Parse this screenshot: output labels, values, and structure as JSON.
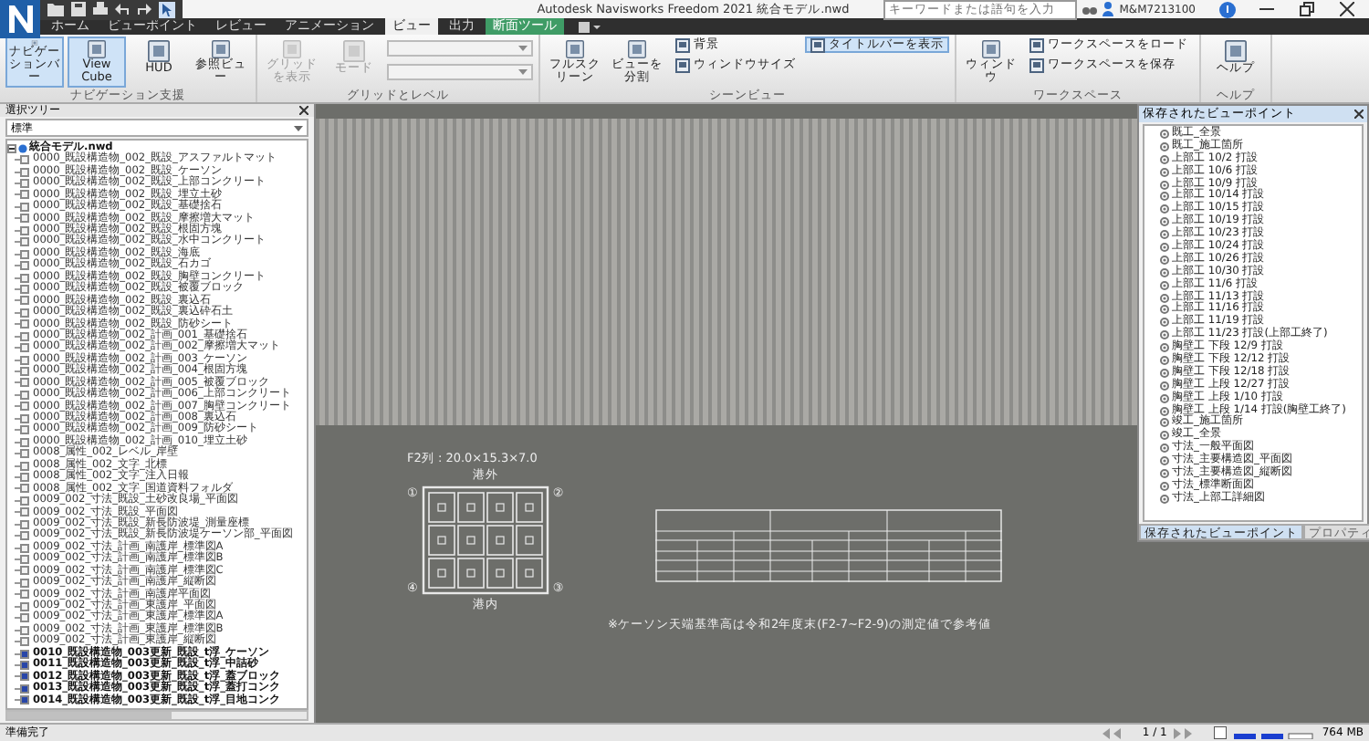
{
  "window": {
    "title": "Autodesk Navisworks Freedom 2021   統合モデル.nwd",
    "search_placeholder": "キーワードまたは語句を入力",
    "user": "M&M7213100"
  },
  "ribbon": {
    "tabs": [
      {
        "label": "ホーム",
        "selected": false,
        "kind": "normal"
      },
      {
        "label": "ビューポイント",
        "selected": false,
        "kind": "normal"
      },
      {
        "label": "レビュー",
        "selected": false,
        "kind": "normal"
      },
      {
        "label": "アニメーション",
        "selected": false,
        "kind": "normal"
      },
      {
        "label": "ビュー",
        "selected": true,
        "kind": "normal"
      },
      {
        "label": "出力",
        "selected": false,
        "kind": "normal"
      },
      {
        "label": "断面ツール",
        "selected": false,
        "kind": "contextual"
      }
    ],
    "groups": [
      {
        "label": "ナビゲーション支援",
        "buttons": [
          {
            "label": "ナビゲーションバー",
            "kind": "large",
            "active": true,
            "disabled": false
          },
          {
            "label": "View Cube",
            "kind": "large",
            "active": true,
            "disabled": false
          },
          {
            "label": "HUD",
            "kind": "large",
            "active": false,
            "disabled": false
          },
          {
            "label": "参照ビュー",
            "kind": "large",
            "active": false,
            "disabled": false
          }
        ]
      },
      {
        "label": "グリッドとレベル",
        "buttons": [
          {
            "label": "グリッドを表示",
            "kind": "large",
            "active": false,
            "disabled": true
          },
          {
            "label": "モード",
            "kind": "large",
            "active": false,
            "disabled": true
          },
          {
            "kind": "combo",
            "disabled": true
          },
          {
            "kind": "combo",
            "disabled": true
          }
        ]
      },
      {
        "label": "シーンビュー",
        "buttons": [
          {
            "label": "フルスクリーン",
            "kind": "large",
            "active": false,
            "disabled": false
          },
          {
            "label": "ビューを分割",
            "kind": "large",
            "active": false,
            "disabled": false
          },
          {
            "label": "背景",
            "kind": "small",
            "active": false,
            "disabled": false
          },
          {
            "label": "ウィンドウサイズ",
            "kind": "small",
            "active": false,
            "disabled": false
          },
          {
            "label": "タイトルバーを表示",
            "kind": "small",
            "active": true,
            "disabled": false
          }
        ]
      },
      {
        "label": "ワークスペース",
        "buttons": [
          {
            "label": "ウィンドウ",
            "kind": "large",
            "active": false,
            "disabled": false
          },
          {
            "label": "ワークスペースをロード",
            "kind": "small",
            "active": false,
            "disabled": false
          },
          {
            "label": "ワークスペースを保存",
            "kind": "small",
            "active": false,
            "disabled": false
          }
        ]
      },
      {
        "label": "ヘルプ",
        "buttons": [
          {
            "label": "ヘルプ",
            "kind": "large",
            "active": false,
            "disabled": false
          }
        ]
      }
    ]
  },
  "selection_tree": {
    "title": "選択ツリー",
    "filter": "標準",
    "root": {
      "label": "統合モデル.nwd",
      "expanded": true,
      "children": [
        {
          "label": "0000_既設構造物_002_既設_アスファルトマット",
          "emphasized": false
        },
        {
          "label": "0000_既設構造物_002_既設_ケーソン",
          "emphasized": false
        },
        {
          "label": "0000_既設構造物_002_既設_上部コンクリート",
          "emphasized": false
        },
        {
          "label": "0000_既設構造物_002_既設_埋立土砂",
          "emphasized": false
        },
        {
          "label": "0000_既設構造物_002_既設_基礎捨石",
          "emphasized": false
        },
        {
          "label": "0000_既設構造物_002_既設_摩擦増大マット",
          "emphasized": false
        },
        {
          "label": "0000_既設構造物_002_既設_根固方塊",
          "emphasized": false
        },
        {
          "label": "0000_既設構造物_002_既設_水中コンクリート",
          "emphasized": false
        },
        {
          "label": "0000_既設構造物_002_既設_海底",
          "emphasized": false
        },
        {
          "label": "0000_既設構造物_002_既設_石カゴ",
          "emphasized": false
        },
        {
          "label": "0000_既設構造物_002_既設_胸壁コンクリート",
          "emphasized": false
        },
        {
          "label": "0000_既設構造物_002_既設_被覆ブロック",
          "emphasized": false
        },
        {
          "label": "0000_既設構造物_002_既設_裏込石",
          "emphasized": false
        },
        {
          "label": "0000_既設構造物_002_既設_裏込砕石土",
          "emphasized": false
        },
        {
          "label": "0000_既設構造物_002_既設_防砂シート",
          "emphasized": false
        },
        {
          "label": "0000_既設構造物_002_計画_001_基礎捨石",
          "emphasized": false
        },
        {
          "label": "0000_既設構造物_002_計画_002_摩擦増大マット",
          "emphasized": false
        },
        {
          "label": "0000_既設構造物_002_計画_003_ケーソン",
          "emphasized": false
        },
        {
          "label": "0000_既設構造物_002_計画_004_根固方塊",
          "emphasized": false
        },
        {
          "label": "0000_既設構造物_002_計画_005_被覆ブロック",
          "emphasized": false
        },
        {
          "label": "0000_既設構造物_002_計画_006_上部コンクリート",
          "emphasized": false
        },
        {
          "label": "0000_既設構造物_002_計画_007_胸壁コンクリート",
          "emphasized": false
        },
        {
          "label": "0000_既設構造物_002_計画_008_裏込石",
          "emphasized": false
        },
        {
          "label": "0000_既設構造物_002_計画_009_防砂シート",
          "emphasized": false
        },
        {
          "label": "0000_既設構造物_002_計画_010_埋立土砂",
          "emphasized": false
        },
        {
          "label": "0008_属性_002_レベル_岸壁",
          "emphasized": false
        },
        {
          "label": "0008_属性_002_文字_北標",
          "emphasized": false
        },
        {
          "label": "0008_属性_002_文字_注入日報",
          "emphasized": false
        },
        {
          "label": "0008_属性_002_文字_国道資料フォルダ",
          "emphasized": false
        },
        {
          "label": "0009_002_寸法_既設_土砂改良場_平面図",
          "emphasized": false
        },
        {
          "label": "0009_002_寸法_既設_平面図",
          "emphasized": false
        },
        {
          "label": "0009_002_寸法_既設_新長防波堤_測量座標",
          "emphasized": false
        },
        {
          "label": "0009_002_寸法_既設_新長防波堤ケーソン部_平面図",
          "emphasized": false
        },
        {
          "label": "0009_002_寸法_計画_南護岸_標準図A",
          "emphasized": false
        },
        {
          "label": "0009_002_寸法_計画_南護岸_標準図B",
          "emphasized": false
        },
        {
          "label": "0009_002_寸法_計画_南護岸_標準図C",
          "emphasized": false
        },
        {
          "label": "0009_002_寸法_計画_南護岸_縦断図",
          "emphasized": false
        },
        {
          "label": "0009_002_寸法_計画_南護岸平面図",
          "emphasized": false
        },
        {
          "label": "0009_002_寸法_計画_東護岸_平面図",
          "emphasized": false
        },
        {
          "label": "0009_002_寸法_計画_東護岸_標準図A",
          "emphasized": false
        },
        {
          "label": "0009_002_寸法_計画_東護岸_標準図B",
          "emphasized": false
        },
        {
          "label": "0009_002_寸法_計画_東護岸_縦断図",
          "emphasized": false
        },
        {
          "label": "0010_既設構造物_003更新_既設_t浮_ケーソン",
          "emphasized": true
        },
        {
          "label": "0011_既設構造物_003更新_既設_t浮_中詰砂",
          "emphasized": true
        },
        {
          "label": "0012_既設構造物_003更新_既設_t浮_蓋ブロック",
          "emphasized": true
        },
        {
          "label": "0013_既設構造物_003更新_既設_t浮_蓋打コンク",
          "emphasized": true
        },
        {
          "label": "0014_既設構造物_003更新_既設_t浮_目地コンク",
          "emphasized": true
        }
      ]
    }
  },
  "viewport": {
    "section_title": "F2列 : 20.0×15.3×7.0",
    "top_label": "港外",
    "bottom_label": "港内",
    "corners": [
      "①",
      "②",
      "④",
      "③"
    ],
    "note": "※ケーソン天端基準高は令和2年度末(F2-7~F2-9)の測定値で参考値"
  },
  "viewpoints_panel": {
    "title": "保存されたビューポイント",
    "items": [
      "既工_全景",
      "既工_施工箇所",
      "上部工 10/2 打設",
      "上部工 10/6 打設",
      "上部工 10/9 打設",
      "上部工 10/14 打設",
      "上部工 10/15 打設",
      "上部工 10/19 打設",
      "上部工 10/23 打設",
      "上部工 10/24 打設",
      "上部工 10/26 打設",
      "上部工 10/30 打設",
      "上部工 11/6 打設",
      "上部工 11/13 打設",
      "上部工 11/16 打設",
      "上部工 11/19 打設",
      "上部工 11/23 打設(上部工終了)",
      "胸壁工 下段 12/9 打設",
      "胸壁工 下段 12/12 打設",
      "胸壁工 下段 12/18 打設",
      "胸壁工 上段 12/27 打設",
      "胸壁工 上段 1/10 打設",
      "胸壁工 上段 1/14 打設(胸壁工終了)",
      "竣工_施工箇所",
      "竣工_全景",
      "寸法_一般平面図",
      "寸法_主要構造図_平面図",
      "寸法_主要構造図_縦断図",
      "寸法_標準断面図",
      "寸法_上部工詳細図"
    ],
    "tabs": [
      {
        "label": "保存されたビューポイント",
        "selected": true
      },
      {
        "label": "プロパティ",
        "selected": false
      }
    ]
  },
  "status_bar": {
    "text": "準備完了",
    "page": "1 / 1",
    "memory": "764 MB"
  }
}
